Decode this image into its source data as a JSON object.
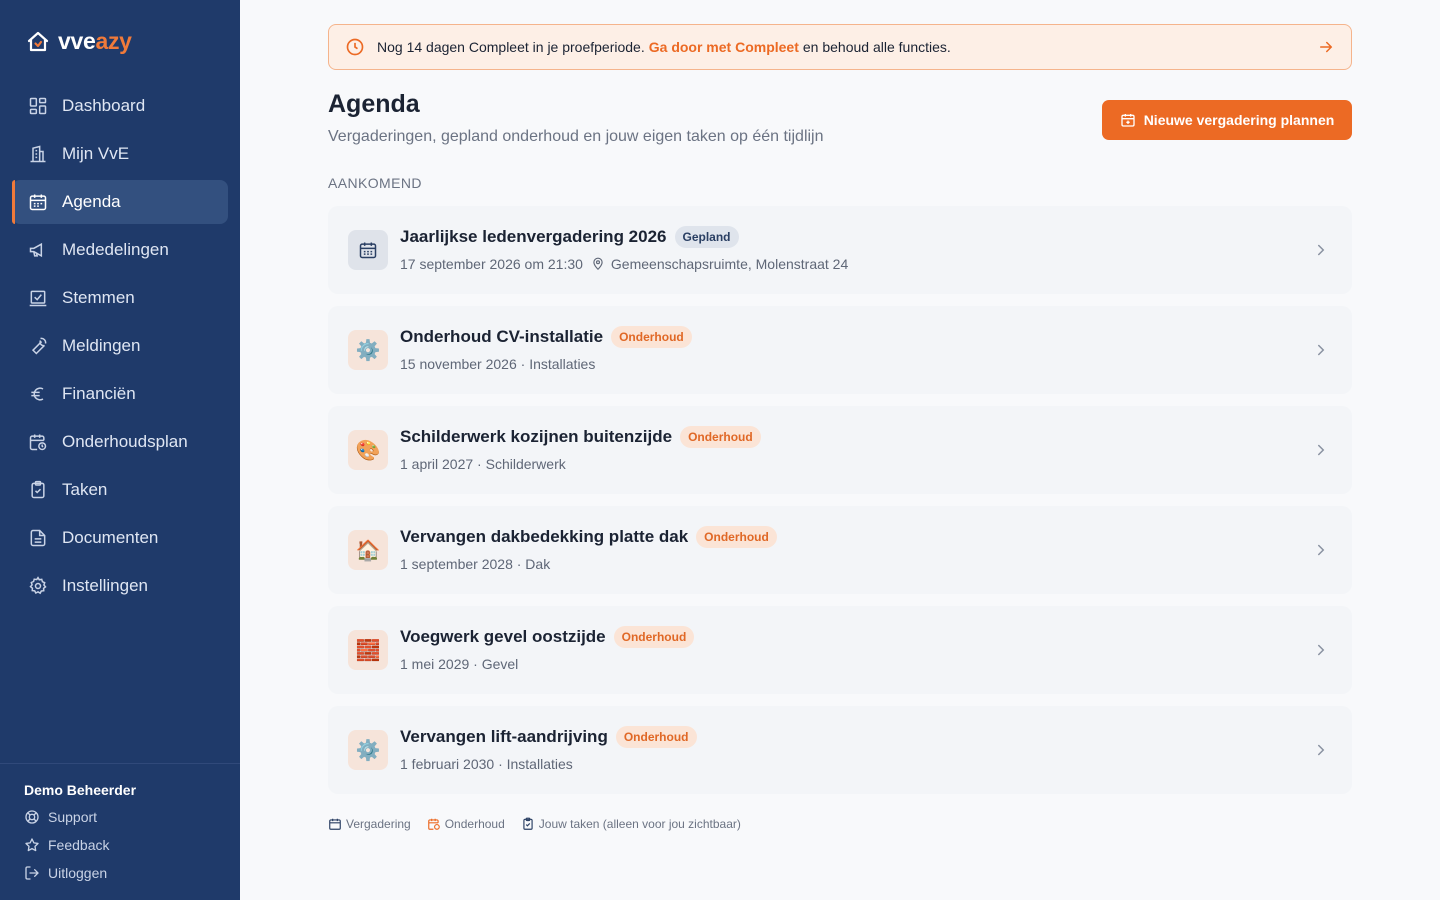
{
  "brand": {
    "prefix": "vve",
    "accent": "azy",
    "accent_color": "#f07a3a"
  },
  "sidebar": {
    "items": [
      {
        "label": "Dashboard",
        "icon": "dashboard-icon"
      },
      {
        "label": "Mijn VvE",
        "icon": "building-icon"
      },
      {
        "label": "Agenda",
        "icon": "calendar-icon",
        "active": true
      },
      {
        "label": "Mededelingen",
        "icon": "megaphone-icon"
      },
      {
        "label": "Stemmen",
        "icon": "vote-icon"
      },
      {
        "label": "Meldingen",
        "icon": "wrench-icon"
      },
      {
        "label": "Financiën",
        "icon": "euro-icon"
      },
      {
        "label": "Onderhoudsplan",
        "icon": "calendar-clock-icon"
      },
      {
        "label": "Taken",
        "icon": "clipboard-check-icon"
      },
      {
        "label": "Documenten",
        "icon": "document-icon"
      },
      {
        "label": "Instellingen",
        "icon": "gear-icon"
      }
    ],
    "user": "Demo Beheerder",
    "support": "Support",
    "feedback": "Feedback",
    "logout": "Uitloggen"
  },
  "trial": {
    "text_before": "Nog 14 dagen Compleet in je proefperiode.",
    "link": "Ga door met Compleet",
    "text_after": "en behoud alle functies."
  },
  "header": {
    "title": "Agenda",
    "subtitle": "Vergaderingen, gepland onderhoud en jouw eigen taken op één tijdlijn",
    "cta": "Nieuwe vergadering plannen"
  },
  "section_label": "AANKOMEND",
  "items": [
    {
      "title": "Jaarlijkse ledenvergadering 2026",
      "badge": "Gepland",
      "date": "17 september 2026 om 21:30",
      "location": "Gemeenschapsruimte, Molenstraat 24"
    },
    {
      "title": "Onderhoud CV-installatie",
      "badge": "Onderhoud",
      "emoji": "⚙️",
      "meta": "15 november 2026 · Installaties"
    },
    {
      "title": "Schilderwerk kozijnen buitenzijde",
      "badge": "Onderhoud",
      "emoji": "🎨",
      "meta": "1 april 2027 · Schilderwerk"
    },
    {
      "title": "Vervangen dakbedekking platte dak",
      "badge": "Onderhoud",
      "emoji": "🏠",
      "meta": "1 september 2028 · Dak"
    },
    {
      "title": "Voegwerk gevel oostzijde",
      "badge": "Onderhoud",
      "emoji": "🧱",
      "meta": "1 mei 2029 · Gevel"
    },
    {
      "title": "Vervangen lift-aandrijving",
      "badge": "Onderhoud",
      "emoji": "⚙️",
      "meta": "1 februari 2030 · Installaties"
    }
  ],
  "legend": {
    "meeting": "Vergadering",
    "maintenance": "Onderhoud",
    "tasks": "Jouw taken (alleen voor jou zichtbaar)"
  },
  "colors": {
    "sidebar": "#1f3a6a",
    "accent": "#ec6a24",
    "active_nav": "#33507f"
  }
}
